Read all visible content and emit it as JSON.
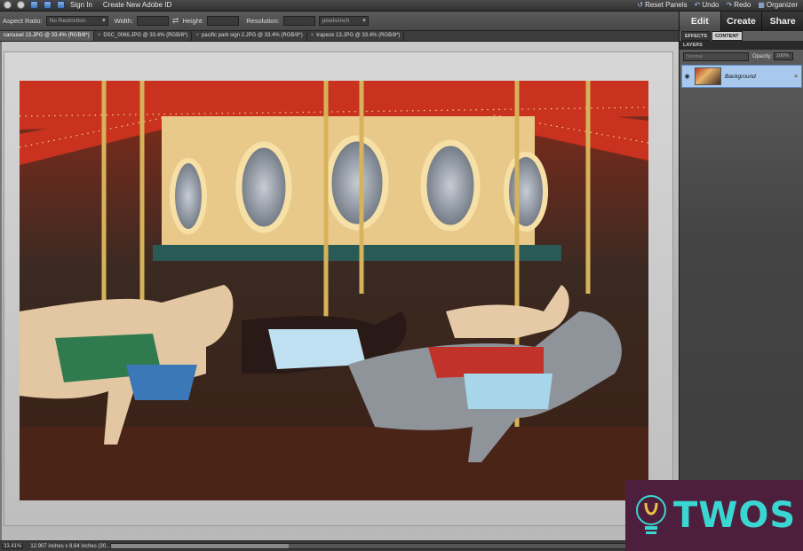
{
  "menubar": {
    "sign_in": "Sign In",
    "create_id": "Create New Adobe ID",
    "reset_panels": "Reset Panels",
    "undo": "Undo",
    "redo": "Redo",
    "organizer": "Organizer"
  },
  "options": {
    "aspect_label": "Aspect Ratio:",
    "aspect_value": "No Restriction",
    "width_label": "Width:",
    "height_label": "Height:",
    "resolution_label": "Resolution:",
    "resolution_unit": "pixels/inch"
  },
  "mode_tabs": [
    "Edit",
    "Create",
    "Share"
  ],
  "doc_tabs": [
    "carousel 13.JPG @ 33.4% (RGB/8*)",
    "DSC_0066.JPG @ 33.4% (RGB/8*)",
    "pacific park sign 2.JPG @ 33.4% (RGB/8*)",
    "trapeze 13.JPG @ 33.4% (RGB/8*)"
  ],
  "panel": {
    "tab_effects": "EFFECTS",
    "tab_content": "CONTENT",
    "layers_title": "LAYERS",
    "blend_mode": "Normal",
    "opacity_label": "Opacity:",
    "opacity_value": "100%",
    "layer_name": "Background"
  },
  "status": {
    "zoom": "33.41%",
    "doc_size": "12.907 inches x 8.64 inches (30..."
  },
  "watermark": {
    "text": "TWOS"
  },
  "colors": {
    "accent_blue": "#a8c8ee",
    "watermark_bg": "#4d1f3d",
    "watermark_text": "#3ad7d2"
  }
}
